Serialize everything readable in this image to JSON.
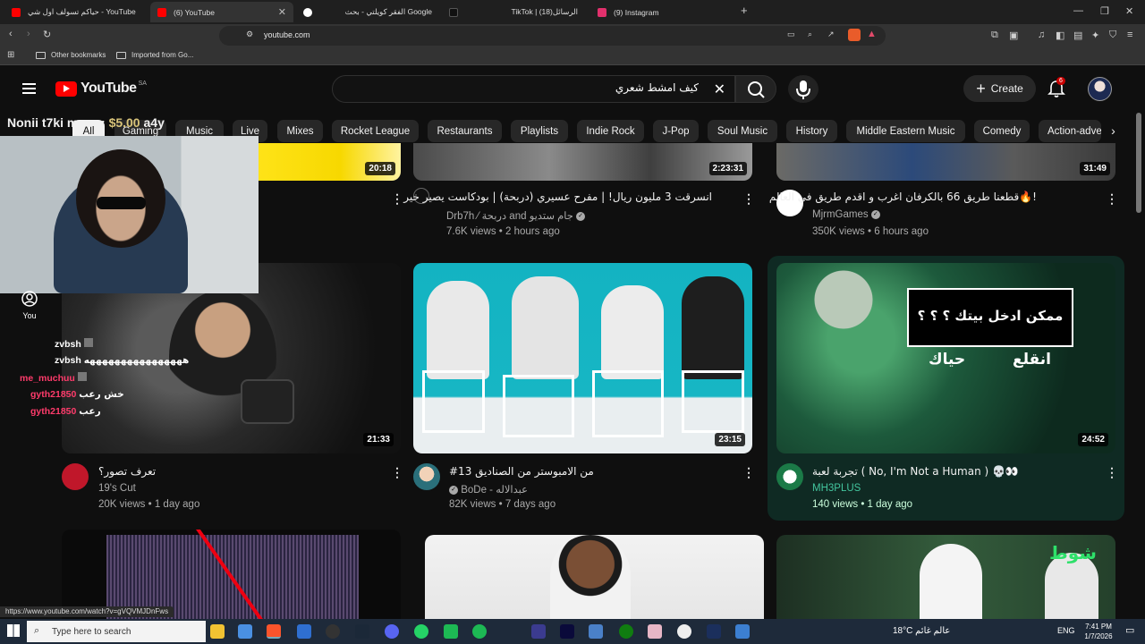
{
  "browser": {
    "tabs": [
      {
        "title": "حياكم تسولف اول شي - YouTube",
        "favicon_color": "#ff0000",
        "active": false
      },
      {
        "title": "(6) YouTube",
        "favicon_color": "#ff0000",
        "active": true
      },
      {
        "title": "الفقر كويلتي - بحث Google",
        "favicon_color": "#ffffff",
        "active": false
      },
      {
        "title": "TikTok | الرسائل(18)",
        "favicon_color": "#111111",
        "active": false
      },
      {
        "title": "(9) Instagram",
        "favicon_color": "#e1306c",
        "active": false
      }
    ],
    "new_tab": "+",
    "url": "youtube.com",
    "bookmarks": [
      "Other bookmarks",
      "Imported from Go..."
    ],
    "status_url": "https://www.youtube.com/watch?v=gVQVMJDnFws"
  },
  "youtube": {
    "logo_text": "YouTube",
    "country_code": "SA",
    "search_value": "كيف امشط شعري",
    "create_label": "Create",
    "notif_count": "6",
    "chips": [
      "All",
      "Gaming",
      "Music",
      "Live",
      "Mixes",
      "Rocket League",
      "Restaurants",
      "Playlists",
      "Indie Rock",
      "J-Pop",
      "Soul Music",
      "History",
      "Middle Eastern Music",
      "Comedy",
      "Action-adve"
    ],
    "sidebar_you": "You",
    "videos_row1": [
      {
        "title": "",
        "channel": "",
        "meta": "",
        "duration": "20:18"
      },
      {
        "title": "انسرقت 3 مليون ريال! | مفرح عسيري (دربحة) | بودكاست يصير خير",
        "channel": "Drb7h ⁄ دربحة and جام ستديو",
        "meta": "7.6K views • 2 hours ago",
        "duration": "2:23:31"
      },
      {
        "title": "قطعنا طريق 66 بالكرفان اغرب و اقدم طريق في العالم🔥!",
        "channel": "MjrmGames",
        "meta": "350K views • 6 hours ago",
        "duration": "31:49"
      }
    ],
    "videos_row2": [
      {
        "title": "تعرف تصور؟",
        "channel": "19's Cut",
        "meta": "20K views • 1 day ago",
        "duration": "21:33"
      },
      {
        "title": "#13 من الامبوستر من الصناديق",
        "channel": "BoDe - عبدالاله",
        "meta": "82K views • 7 days ago",
        "duration": "23:15"
      },
      {
        "title": "تجربة لعبة ( No, I'm Not a Human ) 💀👀",
        "channel": "MH3PLUS",
        "meta": "140 views • 1 day ago",
        "duration": "24:52"
      }
    ],
    "thumb_text_right": [
      "ممكن ادخل بيتك ؟ ؟ ؟",
      "انقلع",
      "حياك"
    ],
    "thumb_text_bottom": "شوط"
  },
  "stream_overlay": {
    "donation_name": "Nonii t7ki moon:",
    "donation_amount": "$5.00",
    "donation_tail": "a4y",
    "chat": [
      {
        "user": "zvbsh",
        "msg": "",
        "color": "#ffffff"
      },
      {
        "user": "zvbsh",
        "msg": "ههههههههههههههههه",
        "color": "#ffffff"
      },
      {
        "user": "me_muchuu",
        "msg": "",
        "color": "#ff3b6b"
      },
      {
        "user": "gyth21850",
        "msg": "خش رعب",
        "color": "#ff3b6b"
      },
      {
        "user": "gyth21850",
        "msg": "رعب",
        "color": "#ff3b6b"
      }
    ]
  },
  "taskbar": {
    "search_placeholder": "Type here to search",
    "weather": "18°C عالم غائم",
    "lang": "ENG",
    "time": "7:41 PM",
    "date": "1/7/2026"
  }
}
